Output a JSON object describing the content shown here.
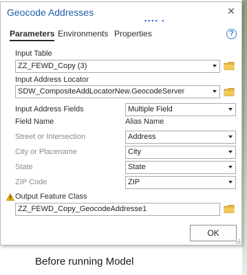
{
  "dialog": {
    "title": "Geocode Addresses",
    "drag_dots": "•••• •",
    "close_glyph": "✕",
    "help_glyph": "?"
  },
  "tabs": [
    {
      "label": "Parameters",
      "active": true
    },
    {
      "label": "Environments",
      "active": false
    },
    {
      "label": "Properties",
      "active": false
    }
  ],
  "params": {
    "input_table_label": "Input Table",
    "input_table_value": "ZZ_FEWD_Copy (3)",
    "locator_label": "Input Address Locator",
    "locator_value": "SDW_CompositeAddLocatorNew.GeocodeServer",
    "address_fields_label": "Input Address Fields",
    "address_fields_value": "Multiple Field",
    "field_name_header": "Field Name",
    "alias_name_header": "Alias Name",
    "field_rows": [
      {
        "field": "Street or Intersection",
        "alias": "Address"
      },
      {
        "field": "City or Placename",
        "alias": "City"
      },
      {
        "field": "State",
        "alias": "State"
      },
      {
        "field": "ZIP Code",
        "alias": "ZIP"
      }
    ],
    "output_label": "Output Feature Class",
    "output_value": "ZZ_FEWD_Copy_GeocodeAddresse1"
  },
  "buttons": {
    "ok": "OK"
  },
  "caption": "Before running Model",
  "colors": {
    "title": "#1f5fa8",
    "accent": "#2f77c8",
    "folder": "#e8b53b",
    "warning": "#f0b400"
  }
}
